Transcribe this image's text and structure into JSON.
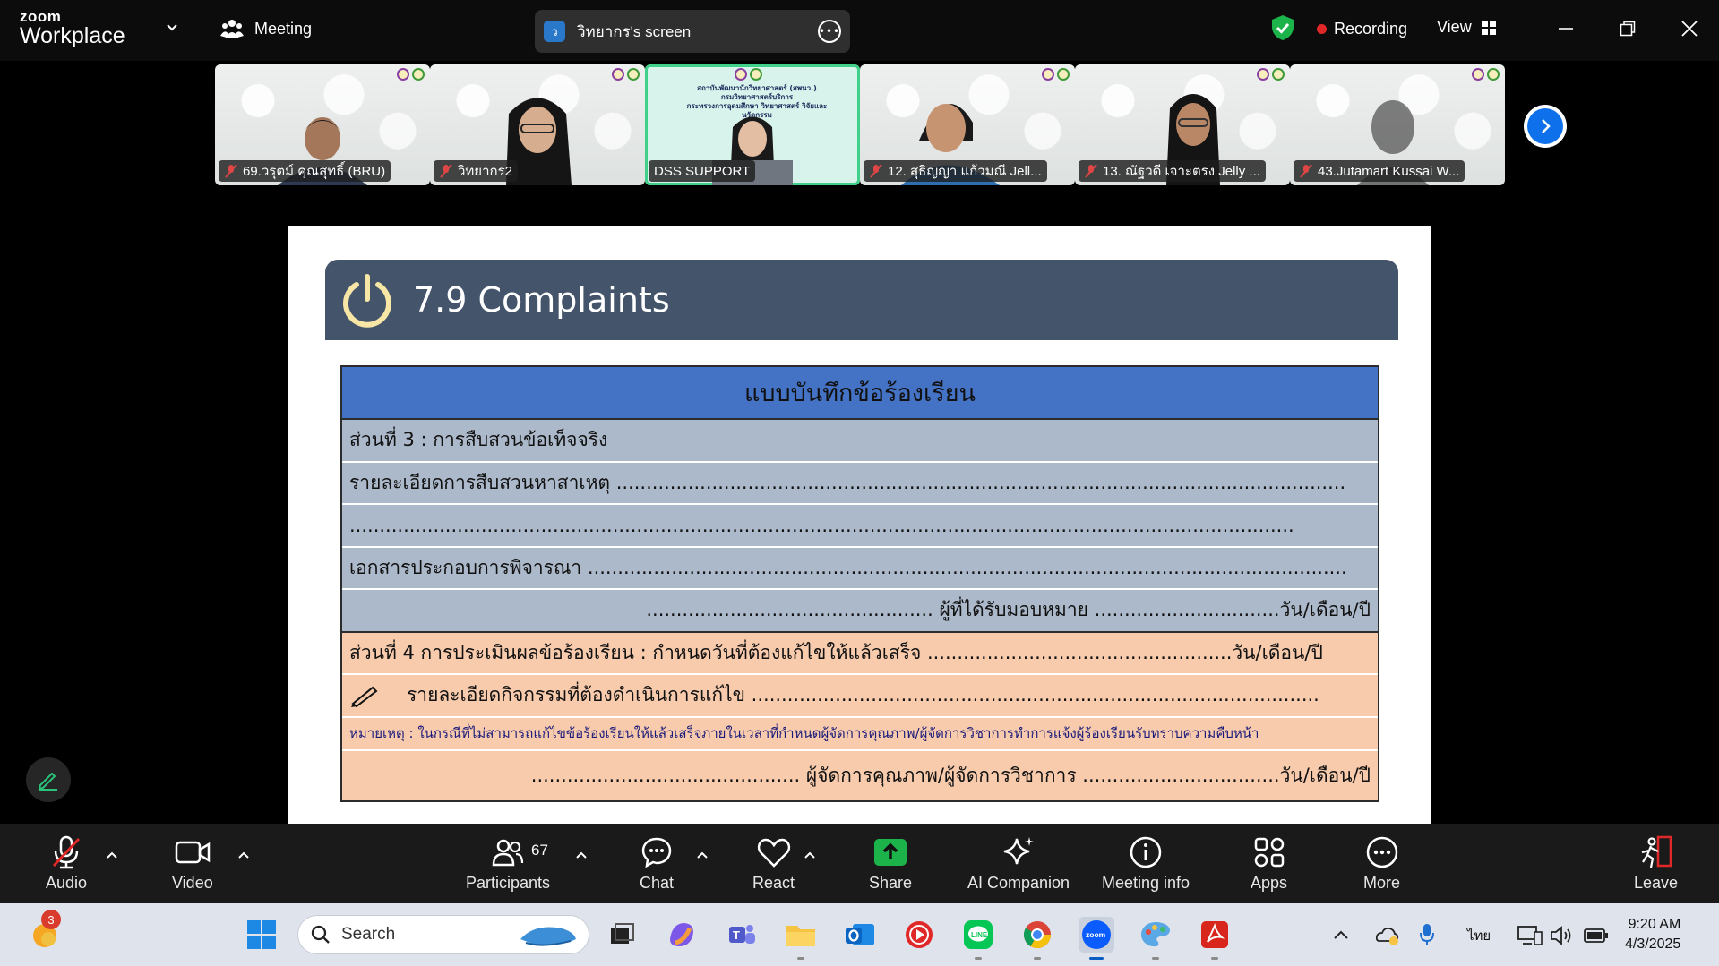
{
  "app": {
    "brand_top": "zoom",
    "brand_bottom": "Workplace"
  },
  "topbar": {
    "meeting_label": "Meeting",
    "screen_share_avatar": "ว",
    "screen_share_label": "วิทยากร's screen",
    "recording_label": "Recording",
    "view_label": "View",
    "colors": {
      "recording_dot": "#e02828",
      "shield": "#1db34b"
    }
  },
  "participants_strip": [
    {
      "name": "69.วรุตม์ คุณสุทธิ์ (BRU)",
      "muted": true,
      "active": false
    },
    {
      "name": "วิทยากร2",
      "muted": true,
      "active": false
    },
    {
      "name": "DSS SUPPORT",
      "muted": false,
      "active": true
    },
    {
      "name": "12. สุธิญญา แก้วมณี Jell...",
      "muted": true,
      "active": false
    },
    {
      "name": "13. ณัฐวดี เจาะตรง Jelly ...",
      "muted": true,
      "active": false
    },
    {
      "name": "43.Jutamart Kussai W...",
      "muted": true,
      "active": false
    }
  ],
  "active_sign": {
    "line1": "สถาบันพัฒนานักวิทยาศาสตร์ (สพนว.)",
    "line2": "กรมวิทยาศาสตร์บริการ",
    "line3": "กระทรวงการอุดมศึกษา วิทยาศาสตร์ วิจัยและนวัตกรรม"
  },
  "slide": {
    "title": "7.9 Complaints",
    "form_header": "แบบบันทึกข้อร้องเรียน",
    "rows": [
      "ส่วนที่ 3 : การสืบสวนข้อเท็จจริง",
      "รายละเอียดการสืบสวนหาสาเหตุ ..........................................................................................................................",
      "..............................................................................................................................................................",
      "เอกสารประกอบการพิจารณา ...............................................................................................................................",
      "................................................ ผู้ที่ได้รับมอบหมาย ...............................วัน/เดือน/ปี",
      "ส่วนที่ 4 การประเมินผลข้อร้องเรียน : กำหนดวันที่ต้องแก้ไขให้แล้วเสร็จ ...................................................วัน/เดือน/ปี",
      "รายละเอียดกิจกรรมที่ต้องดำเนินการแก้ไข ...............................................................................................",
      "หมายเหตุ : ในกรณีที่ไม่สามารถแก้ไขข้อร้องเรียนให้แล้วเสร็จภายในเวลาที่กำหนดผู้จัดการคุณภาพ/ผู้จัดการวิชาการทำการแจ้งผู้ร้องเรียนรับทราบความคืบหน้า",
      "............................................. ผู้จัดการคุณภาพ/ผู้จัดการวิชาการ .................................วัน/เดือน/ปี"
    ],
    "colors": {
      "title_bar": "#44546a",
      "header": "#4472c4",
      "gray": "#acb9ca",
      "peach": "#f8cbad"
    }
  },
  "toolbar": {
    "audio": "Audio",
    "video": "Video",
    "participants": "Participants",
    "participants_count": "67",
    "chat": "Chat",
    "react": "React",
    "share": "Share",
    "ai_companion": "AI Companion",
    "meeting_info": "Meeting info",
    "apps": "Apps",
    "more": "More",
    "leave": "Leave",
    "colors": {
      "share": "#1db34b",
      "leave": "#e02828"
    }
  },
  "taskbar": {
    "search_placeholder": "Search",
    "notification_badge": "3",
    "language": "ไทย",
    "time": "9:20 AM",
    "date": "4/3/2025"
  }
}
